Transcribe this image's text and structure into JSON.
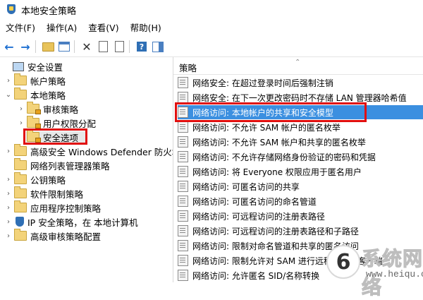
{
  "window": {
    "title": "本地安全策略"
  },
  "menu": [
    "文件(F)",
    "操作(A)",
    "查看(V)",
    "帮助(H)"
  ],
  "toolbar_icons": [
    "back-arrow-icon",
    "forward-arrow-icon",
    "folder-up-icon",
    "show-hide-tree-icon",
    "delete-icon",
    "properties-icon",
    "export-icon",
    "help-icon",
    "action-pane-icon"
  ],
  "tree": [
    {
      "label": "安全设置",
      "indent": 0,
      "expand": "",
      "icon": "pc"
    },
    {
      "label": "帐户策略",
      "indent": 1,
      "expand": ">",
      "icon": "folder"
    },
    {
      "label": "本地策略",
      "indent": 1,
      "expand": "v",
      "icon": "folder"
    },
    {
      "label": "审核策略",
      "indent": 2,
      "expand": ">",
      "icon": "folder-lock"
    },
    {
      "label": "用户权限分配",
      "indent": 2,
      "expand": ">",
      "icon": "folder-lock"
    },
    {
      "label": "安全选项",
      "indent": 2,
      "expand": "",
      "icon": "folder-lock"
    },
    {
      "label": "高级安全 Windows Defender 防火墙",
      "indent": 1,
      "expand": ">",
      "icon": "folder"
    },
    {
      "label": "网络列表管理器策略",
      "indent": 1,
      "expand": "",
      "icon": "folder"
    },
    {
      "label": "公钥策略",
      "indent": 1,
      "expand": ">",
      "icon": "folder"
    },
    {
      "label": "软件限制策略",
      "indent": 1,
      "expand": ">",
      "icon": "folder"
    },
    {
      "label": "应用程序控制策略",
      "indent": 1,
      "expand": ">",
      "icon": "folder"
    },
    {
      "label": "IP 安全策略，在 本地计算机",
      "indent": 1,
      "expand": ">",
      "icon": "shield"
    },
    {
      "label": "高级审核策略配置",
      "indent": 1,
      "expand": ">",
      "icon": "folder"
    }
  ],
  "policy_header": "策略",
  "policies": [
    "网络安全: 在超过登录时间后强制注销",
    "网络安全: 在下一次更改密码时不存储 LAN 管理器哈希值",
    "网络访问: 本地帐户的共享和安全模型",
    "网络访问: 不允许 SAM 帐户的匿名枚举",
    "网络访问: 不允许 SAM 帐户和共享的匿名枚举",
    "网络访问: 不允许存储网络身份验证的密码和凭据",
    "网络访问: 将 Everyone 权限应用于匿名用户",
    "网络访问: 可匿名访问的共享",
    "网络访问: 可匿名访问的命名管道",
    "网络访问: 可远程访问的注册表路径",
    "网络访问: 可远程访问的注册表路径和子路径",
    "网络访问: 限制对命名管道和共享的匿名访问",
    "网络访问: 限制允许对 SAM 进行远程调用的客户端",
    "网络访问: 允许匿名 SID/名称转换"
  ],
  "selected_policy_index": 2,
  "watermark": {
    "text": "系统网络",
    "url": "www.heiqu.com"
  },
  "colors": {
    "selection": "#3b8fe0",
    "highlight_box": "#e10f0f"
  }
}
